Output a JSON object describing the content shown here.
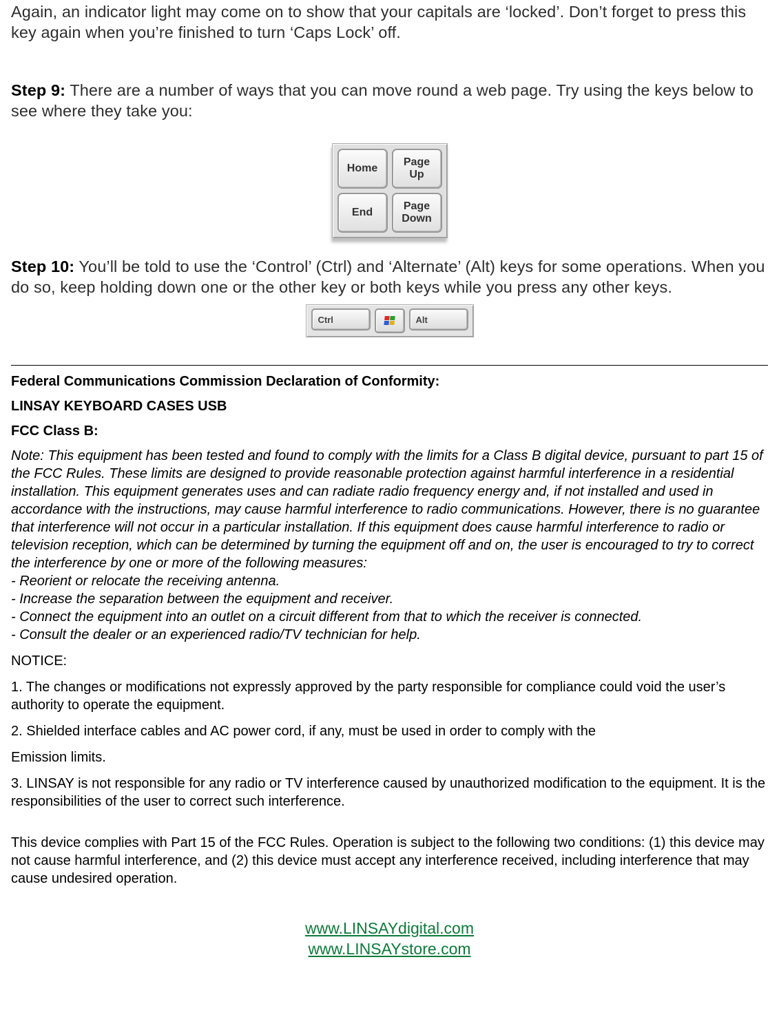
{
  "intro_paragraph": "Again, an indicator light may come on to show that your capitals are ‘locked’. Don’t forget to press this key again when you’re finished to turn ‘Caps Lock’ off.",
  "step9": {
    "label": "Step 9:",
    "text": " There are a number of ways that you can move round a web page. Try using the keys below to see where they take you:",
    "keys": {
      "topLeft": "Home",
      "topRight": "Page\nUp",
      "bottomLeft": "End",
      "bottomRight": "Page\nDown"
    }
  },
  "step10": {
    "label": "Step 10:",
    "text": " You’ll be told to use the ‘Control’ (Ctrl) and ‘Alternate’ (Alt) keys for some operations. When you do so, keep holding down one or the other key or both keys while you press any other keys.",
    "keys": {
      "ctrl": "Ctrl",
      "alt": "Alt"
    }
  },
  "fcc": {
    "title": "Federal Communications Commission Declaration of Conformity:",
    "product": "LINSAY KEYBOARD CASES USB",
    "classb": "FCC Class B:",
    "note_body": "Note: This equipment has been tested and found to comply with the limits for a Class B digital device, pursuant to part 15 of the FCC Rules. These limits are designed to provide reasonable protection against harmful interference in a residential installation. This equipment generates uses and can radiate radio frequency energy and, if not installed and used in accordance with the instructions, may cause harmful interference to radio communications. However, there is no guarantee that interference will not occur in a particular installation. If this equipment does cause harmful interference to radio or television reception, which can be determined by turning the equipment off and on, the user is encouraged to try to correct the interference by one or more of the following measures:",
    "measures": [
      "- Reorient or relocate the receiving antenna.",
      "- Increase the separation between the equipment and receiver.",
      "- Connect the equipment into an outlet on a circuit different from that to which the receiver is connected.",
      "- Consult the dealer or an experienced radio/TV technician for help."
    ],
    "notice_label": "NOTICE:",
    "notice1": "1. The changes or modifications not expressly approved by the party responsible for compliance could void the user’s authority to operate the equipment.",
    "notice2": "2. Shielded interface cables and AC power cord, if any, must be used in order to comply with the",
    "notice2b": "Emission limits.",
    "notice3": "3. LINSAY is not responsible for any radio or TV interference caused by unauthorized modification to the equipment. It is the responsibilities of the user to correct such interference.",
    "compliance": "This device complies with Part 15 of the FCC Rules. Operation is subject to the following two conditions: (1) this device may not cause harmful interference, and (2) this device must accept any interference received, including interference that may cause undesired operation."
  },
  "links": {
    "url1": "www.LINSAYdigital.com",
    "url2": "www.LINSAYstore.com"
  }
}
